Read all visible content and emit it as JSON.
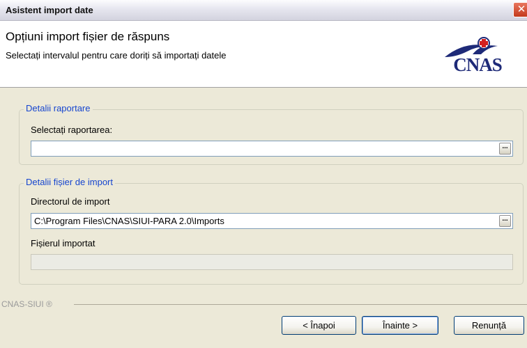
{
  "window": {
    "title": "Asistent import date"
  },
  "header": {
    "title": "Opțiuni import fișier de răspuns",
    "subtitle": "Selectați intervalul pentru care doriți să importați datele",
    "logo_text": "CNAS"
  },
  "group_report": {
    "legend": "Detalii raportare",
    "label": "Selectați raportarea:",
    "value": "",
    "browse_label": "..."
  },
  "group_import": {
    "legend": "Detalii fișier de import",
    "dir_label": "Directorul de import",
    "dir_value": "C:\\Program Files\\CNAS\\SIUI-PARA 2.0\\Imports",
    "browse_label": "...",
    "file_label": "Fișierul importat",
    "file_value": ""
  },
  "footer": {
    "brand": "CNAS-SIUI ®",
    "back_label": "< Înapoi",
    "next_label": "Înainte >",
    "cancel_label": "Renunță"
  },
  "colors": {
    "legend": "#1645cf",
    "logo": "#1e2a78",
    "window_bg": "#ece9d8"
  }
}
